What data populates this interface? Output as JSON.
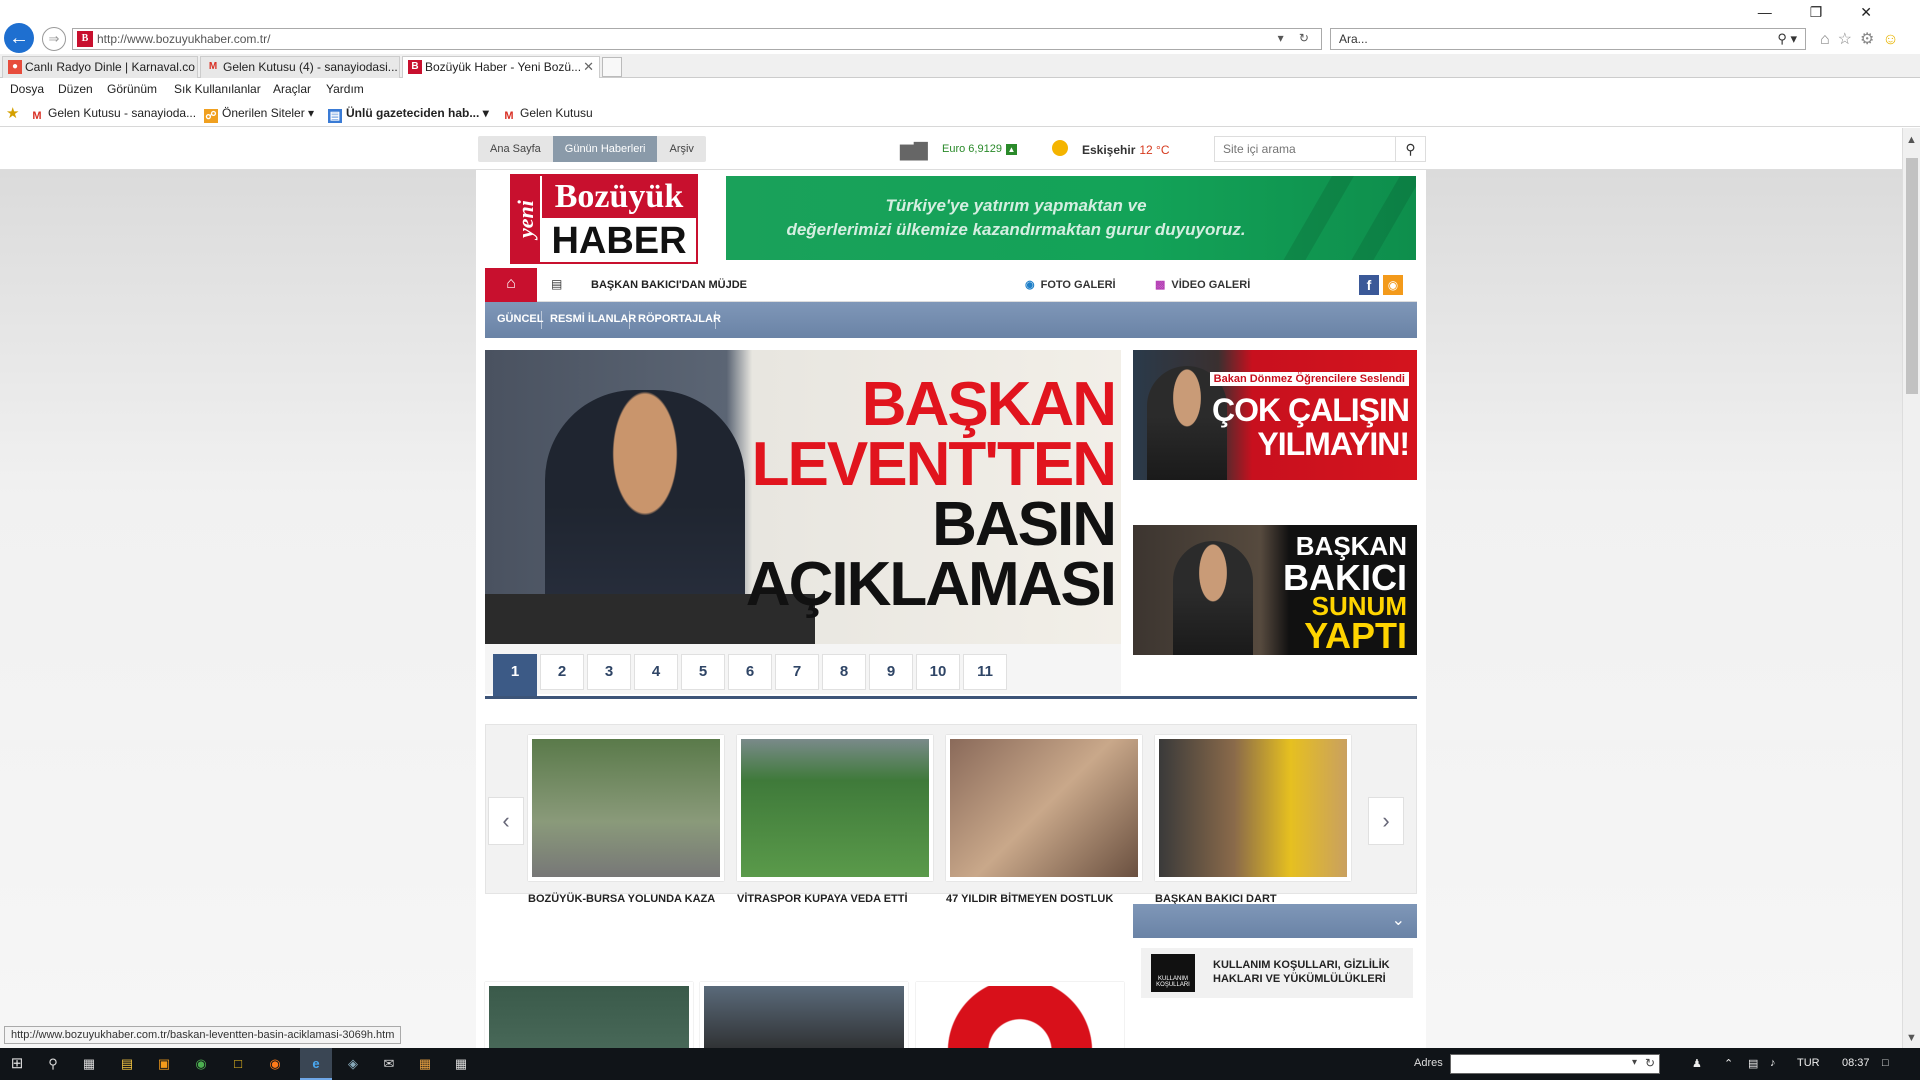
{
  "browser": {
    "url": "http://www.bozuyukhaber.com.tr/",
    "search_placeholder": "Ara...",
    "tabs": [
      {
        "label": "Canlı Radyo Dinle | Karnaval.co",
        "active": false
      },
      {
        "label": "Gelen Kutusu (4) - sanayiodasi...",
        "active": false
      },
      {
        "label": "Bozüyük Haber - Yeni Bozü...",
        "active": true
      }
    ],
    "menu": [
      "Dosya",
      "Düzen",
      "Görünüm",
      "Sık Kullanılanlar",
      "Araçlar",
      "Yardım"
    ],
    "favorites": [
      {
        "label": "Gelen Kutusu - sanayioda...",
        "icon": "gmail-icon"
      },
      {
        "label": "Önerilen Siteler",
        "icon": "suggested-sites-icon"
      },
      {
        "label": "Ünlü gazeteciden hab...",
        "icon": "news-feed-icon"
      },
      {
        "label": "Gelen Kutusu",
        "icon": "gmail-icon"
      }
    ],
    "status_url": "http://www.bozuyukhaber.com.tr/baskan-leventten-basin-aciklamasi-3069h.htm"
  },
  "topbar": {
    "nav": [
      "Ana Sayfa",
      "Günün Haberleri",
      "Arşiv"
    ],
    "active_nav": "Günün Haberleri",
    "currency_label": "Euro 6,9129",
    "city": "Eskişehir",
    "temp": "12 °C",
    "search_placeholder": "Site içi arama"
  },
  "logo": {
    "yeni": "yeni",
    "top": "Bozüyük",
    "bottom": "HABER"
  },
  "banner": {
    "line1": "Türkiye'ye yatırım yapmaktan ve",
    "line2": "değerlerimizi ülkemize kazandırmaktan gurur duyuyoruz."
  },
  "navbar": {
    "ticker": "BAŞKAN BAKICI'DAN MÜJDE",
    "foto": "FOTO GALERİ",
    "video": "VİDEO GALERİ",
    "categories": [
      "GÜNCEL",
      "RESMİ İLANLAR",
      "RÖPORTAJLAR"
    ]
  },
  "slider": {
    "headline": [
      "BAŞKAN",
      "LEVENT'TEN",
      "BASIN",
      "AÇIKLAMASI"
    ],
    "pages": [
      "1",
      "2",
      "3",
      "4",
      "5",
      "6",
      "7",
      "8",
      "9",
      "10",
      "11"
    ],
    "active_page": "1"
  },
  "side_ads": {
    "ad1": {
      "sub": "Bakan Dönmez Öğrencilere Seslendi",
      "line1": "ÇOK ÇALIŞIN",
      "line2": "YILMAYIN!"
    },
    "ad2": {
      "line1": "BAŞKAN",
      "line2": "BAKICI",
      "line3": "SUNUM",
      "line4": "YAPTI"
    }
  },
  "carousel": [
    {
      "caption": "BOZÜYÜK-BURSA YOLUNDA KAZA"
    },
    {
      "caption": "VİTRASPOR KUPAYA VEDA ETTİ"
    },
    {
      "caption": "47 YILDIR BİTMEYEN DOSTLUK"
    },
    {
      "caption": "BAŞKAN BAKICI DART ŞAMPİYONLARINI MİSAFİR ETTİ"
    }
  ],
  "terms": {
    "text": "KULLANIM KOŞULLARI, GİZLİLİK HAKLARI VE YÜKÜMLÜLÜKLERİ",
    "icon_caption": "KULLANIM KOŞULLARI"
  },
  "taskbar": {
    "adres_label": "Adres",
    "lang": "TUR",
    "time": "08:37"
  },
  "colors": {
    "brand_red": "#c8102e",
    "nav_blue": "#6a83a6",
    "pager_blue": "#3c5a86",
    "banner_green": "#13a358"
  }
}
